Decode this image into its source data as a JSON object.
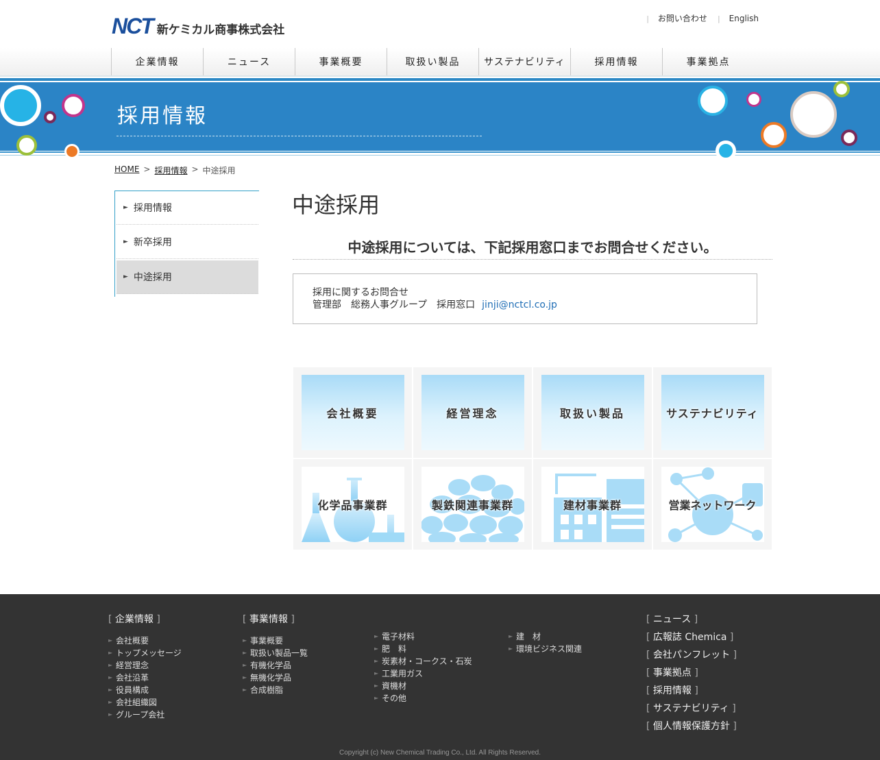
{
  "header": {
    "logo_mark": "NCT",
    "logo_text": "新ケミカル商事株式会社",
    "util_links": [
      "お問い合わせ",
      "English"
    ]
  },
  "gnav": [
    "企業情報",
    "ニュース",
    "事業概要",
    "取扱い製品",
    "サステナビリティ",
    "採用情報",
    "事業拠点"
  ],
  "banner": {
    "title": "採用情報"
  },
  "breadcrumb": {
    "home": "HOME",
    "sep": ">",
    "parent": "採用情報",
    "current": "中途採用"
  },
  "side_nav": [
    "採用情報",
    "新卒採用",
    "中途採用"
  ],
  "main": {
    "title": "中途採用",
    "lead": "中途採用については、下記採用窓口までお問合せください。",
    "contact_line1": "採用に関するお問合せ",
    "contact_line2": "管理部　総務人事グループ　採用窓口",
    "contact_email": "jinji@nctcl.co.jp"
  },
  "tiles": [
    "会社概要",
    "経営理念",
    "取扱い製品",
    "サステナビリティ",
    "化学品事業群",
    "製鉄関連事業群",
    "建材事業群",
    "営業ネットワーク"
  ],
  "footer": {
    "col1_head": "企業情報",
    "col1_links": [
      "会社概要",
      "トップメッセージ",
      "経営理念",
      "会社沿革",
      "役員構成",
      "会社組織図",
      "グループ会社"
    ],
    "col2_head": "事業情報",
    "col2_links": [
      "事業概要",
      "取扱い製品一覧",
      "有機化学品",
      "無機化学品",
      "合成樹脂"
    ],
    "col3_links": [
      "電子材料",
      "肥　料",
      "炭素材・コークス・石炭",
      "工業用ガス",
      "資機材",
      "その他"
    ],
    "col4_links": [
      "建　材",
      "環境ビジネス関連"
    ],
    "right_links": [
      "ニュース",
      "広報誌 Chemica",
      "会社パンフレット",
      "事業拠点",
      "採用情報",
      "サステナビリティ",
      "個人情報保護方針"
    ],
    "copyright": "Copyright (c) New Chemical Trading Co., Ltd. All Rights Reserved."
  },
  "colors": {
    "brand_blue": "#2b84c6",
    "link_blue": "#1e6db5",
    "footer_bg": "#333333"
  }
}
